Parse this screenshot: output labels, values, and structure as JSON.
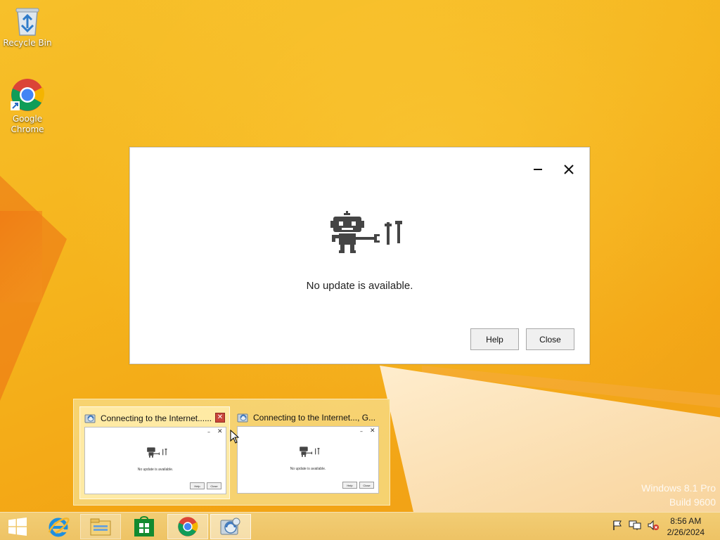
{
  "desktop": {
    "icons": [
      {
        "label": "Recycle Bin",
        "icon": "recycle-bin-icon"
      },
      {
        "label": "Google Chrome",
        "icon": "chrome-icon"
      }
    ]
  },
  "dialog": {
    "message": "No update is available.",
    "help_label": "Help",
    "close_label": "Close",
    "minimize_glyph": "–",
    "close_glyph": "✕",
    "illustration": "robot-with-tools-icon"
  },
  "thumbnails": [
    {
      "title": "Connecting to the Internet......",
      "message": "No update is available.",
      "help": "Help",
      "close": "Close",
      "active": true
    },
    {
      "title": "Connecting to the Internet..., G...",
      "message": "No update is available.",
      "help": "Help",
      "close": "Close",
      "active": false
    }
  ],
  "watermark": {
    "line1": "Windows 8.1 Pro",
    "line2": "Build 9600"
  },
  "taskbar": {
    "items": [
      "start-button",
      "internet-explorer",
      "file-explorer",
      "windows-store",
      "google-chrome",
      "updater"
    ],
    "tray_icons": [
      "flag-icon",
      "network-icon",
      "volume-muted-icon"
    ],
    "time": "8:56 AM",
    "date": "2/26/2024"
  },
  "colors": {
    "accent": "#f3b01c",
    "taskbar": "#f0c86a",
    "dialog_bg": "#ffffff",
    "robot": "#444444"
  }
}
